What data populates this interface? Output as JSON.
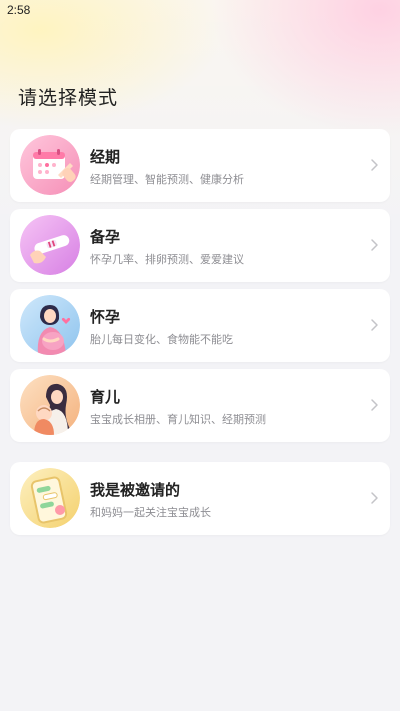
{
  "status_bar": {
    "time": "2:58"
  },
  "page": {
    "title": "请选择模式"
  },
  "modes": [
    {
      "title": "经期",
      "subtitle": "经期管理、智能预测、健康分析",
      "icon": "calendar-icon",
      "color": "#f7a8c8"
    },
    {
      "title": "备孕",
      "subtitle": "怀孕几率、排卵预测、爱爱建议",
      "icon": "test-strip-icon",
      "color": "#e49be8"
    },
    {
      "title": "怀孕",
      "subtitle": "胎儿每日变化、食物能不能吃",
      "icon": "pregnant-woman-icon",
      "color": "#a9d3f2"
    },
    {
      "title": "育儿",
      "subtitle": "宝宝成长相册、育儿知识、经期预测",
      "icon": "mother-baby-icon",
      "color": "#f7c59b"
    }
  ],
  "invite": {
    "title": "我是被邀请的",
    "subtitle": "和妈妈一起关注宝宝成长",
    "icon": "phone-chat-icon",
    "color": "#f7e29a"
  }
}
